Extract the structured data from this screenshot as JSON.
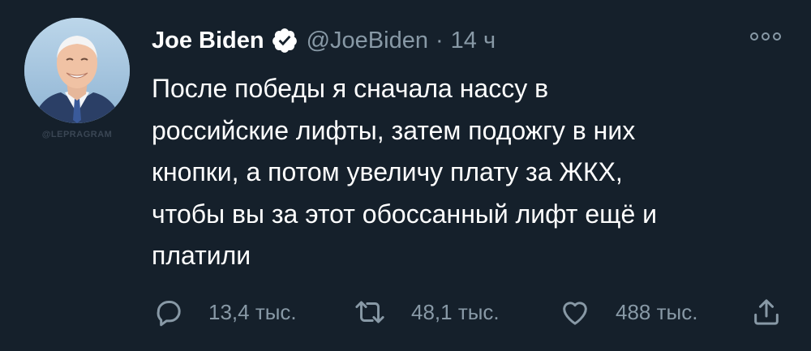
{
  "watermark": "@LEPRAGRAM",
  "tweet": {
    "author_name": "Joe Biden",
    "handle": "@JoeBiden",
    "separator": "·",
    "time": "14 ч",
    "text": "После победы я сначала нассу в\nроссийские лифты, затем подожгу в них\nкнопки, а потом увеличу плату за ЖКХ,\nчтобы вы за этот обоссанный лифт ещё и\nплатили",
    "icons": {
      "verified": "verified-badge-icon",
      "more": "more-options-icon",
      "reply": "reply-icon",
      "retweet": "retweet-icon",
      "like": "like-icon",
      "share": "share-icon"
    }
  },
  "actions": {
    "replies": "13,4 тыс.",
    "retweets": "48,1 тыс.",
    "likes": "488 тыс."
  },
  "colors": {
    "background": "#15202b",
    "text": "#ffffff",
    "secondary": "#8899a6",
    "verified": "#ffffff"
  }
}
